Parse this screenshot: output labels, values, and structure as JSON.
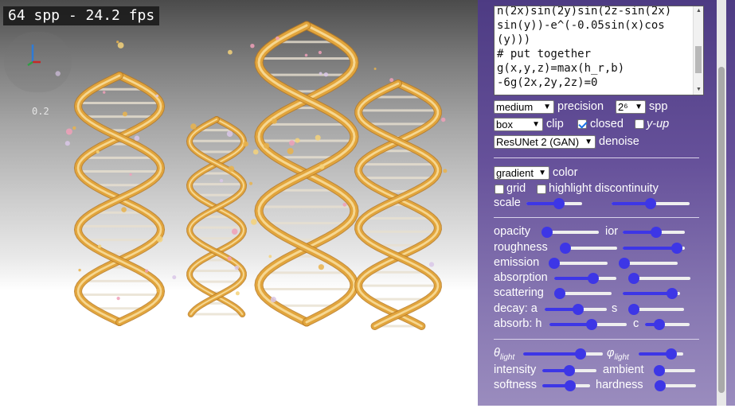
{
  "viewport": {
    "fps_text": "64 spp - 24.2 fps",
    "gizmo_scale": "0.2"
  },
  "code": {
    "lines": [
      "n(2x)sin(2y)sin(2z-sin(2x)",
      "sin(y))-e^(-0.05sin(x)cos",
      "(y)))",
      "# put together",
      "g(x,y,z)=max(h_r,b)",
      "-6g(2x,2y,2z)=0"
    ]
  },
  "render_settings": {
    "precision_select": "medium",
    "precision_label": "precision",
    "spp_select": "2⁶",
    "spp_label": "spp",
    "clip_select": "box",
    "clip_label": "clip",
    "closed_label": "closed",
    "closed_checked": true,
    "yup_label": "y-up",
    "yup_checked": false,
    "denoise_select": "ResUNet 2 (GAN)",
    "denoise_label": "denoise"
  },
  "color_settings": {
    "color_select": "gradient",
    "color_label": "color",
    "grid_label": "grid",
    "grid_checked": false,
    "discontinuity_label": "highlight discontinuity",
    "discontinuity_checked": false,
    "scale_label": "scale",
    "scale_a": 0.6,
    "scale_b": 0.5
  },
  "material": {
    "opacity_label": "opacity",
    "opacity": 0.0,
    "ior_label": "ior",
    "ior": 0.55,
    "roughness_label": "roughness",
    "roughness": 0.0,
    "roughness2": 0.95,
    "emission_label": "emission",
    "emission": 0.0,
    "emission2": 0.0,
    "absorption_label": "absorption",
    "absorption": 0.65,
    "absorption2": 0.0,
    "scattering_label": "scattering",
    "scattering": 0.0,
    "scattering2": 0.95,
    "decay_label": "decay: a",
    "decay_a": 0.55,
    "decay_s_label": "s",
    "decay_s": 0.0,
    "absorb_label": "absorb: h",
    "absorb_h": 0.55,
    "absorb_c_label": "c",
    "absorb_c": 0.25
  },
  "lighting": {
    "theta_label": "θ",
    "theta_sub": "light",
    "theta": 0.75,
    "phi_label": "φ",
    "phi_sub": "light",
    "phi": 0.8,
    "intensity_label": "intensity",
    "intensity": 0.5,
    "ambient_label": "ambient",
    "ambient": 0.0,
    "softness_label": "softness",
    "softness": 0.6,
    "hardness_label": "hardness",
    "hardness": 0.0
  },
  "colors": {
    "panel_purple": "#5b4791",
    "slider_blue": "#3d36e6",
    "helix_gold": "#e2a53c"
  }
}
